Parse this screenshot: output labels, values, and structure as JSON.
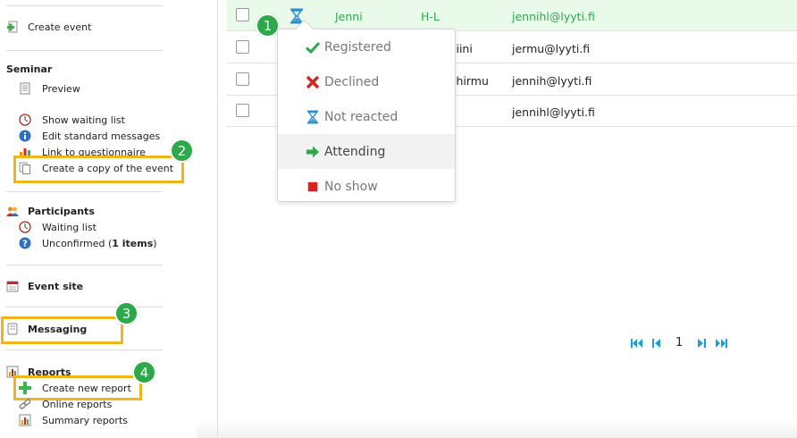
{
  "sidebar": {
    "create_event": "Create event",
    "seminar": {
      "heading": "Seminar",
      "preview": "Preview",
      "show_waiting_list": "Show waiting list",
      "edit_standard_messages": "Edit standard messages",
      "link_to_questionnaire": "Link to questionnaire",
      "create_copy": "Create a copy of the event"
    },
    "participants": {
      "heading": "Participants",
      "waiting_list": "Waiting list",
      "unconfirmed_prefix": "Unconfirmed (",
      "unconfirmed_count": "1 items",
      "unconfirmed_suffix": ")"
    },
    "event_site": "Event site",
    "messaging": "Messaging",
    "reports": {
      "heading": "Reports",
      "create_new_report": "Create new report",
      "online_reports": "Online reports",
      "summary_reports": "Summary reports"
    }
  },
  "badges": [
    "1",
    "2",
    "3",
    "4"
  ],
  "table": {
    "rows": [
      {
        "first": "Jenni",
        "last": "H-L",
        "email": "jennihl@lyyti.fi",
        "highlight": true
      },
      {
        "first": "",
        "last": "liini",
        "email": "jermu@lyyti.fi",
        "highlight": false
      },
      {
        "first": "",
        "last": "ihirmu",
        "email": "jennih@lyyti.fi",
        "highlight": false
      },
      {
        "first": "",
        "last": "",
        "email": "jennihl@lyyti.fi",
        "highlight": false
      }
    ]
  },
  "status_menu": {
    "items": [
      {
        "label": "Registered",
        "icon": "check-icon",
        "color": "#2ea84a"
      },
      {
        "label": "Declined",
        "icon": "x-icon",
        "color": "#d9231f"
      },
      {
        "label": "Not reacted",
        "icon": "hourglass-icon",
        "color": "#2a8ed0"
      },
      {
        "label": "Attending",
        "icon": "arrow-right-icon",
        "color": "#2ea84a"
      },
      {
        "label": "No show",
        "icon": "square-icon",
        "color": "#d9231f"
      }
    ]
  },
  "pager": {
    "current_page": "1"
  },
  "colors": {
    "accent_green": "#2ea84a",
    "highlight_orange": "#f1b51c",
    "pager_blue": "#1aa0d8"
  }
}
